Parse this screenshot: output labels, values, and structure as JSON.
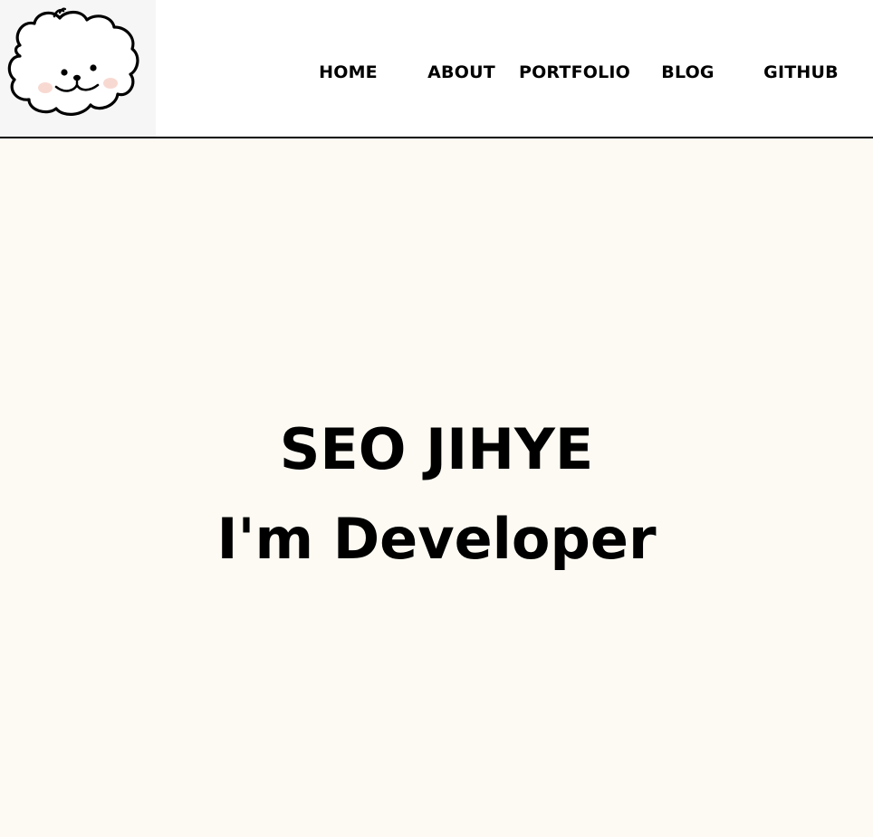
{
  "header": {
    "logo_icon": "poodle-face-icon",
    "nav": [
      {
        "label": "HOME"
      },
      {
        "label": "ABOUT"
      },
      {
        "label": "PORTFOLIO"
      },
      {
        "label": "BLOG"
      },
      {
        "label": "GITHUB"
      }
    ]
  },
  "hero": {
    "name": "SEO JIHYE",
    "tagline": "I'm Developer"
  },
  "colors": {
    "header_bg": "#ffffff",
    "logo_bg": "#f6f6f6",
    "hero_bg": "#fdfaf3",
    "text": "#000000",
    "cheek": "#f8d9d2"
  }
}
